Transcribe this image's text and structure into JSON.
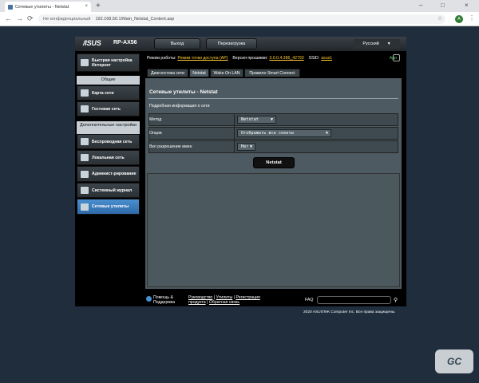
{
  "browser": {
    "tab_title": "Сетевые утилиты - Netstat",
    "close_glyph": "×",
    "newtab_glyph": "+",
    "nav": {
      "back": "←",
      "forward": "→",
      "reload": "⟳"
    },
    "security_label": "Не конфиденциальный",
    "url": "192.168.50.1/Main_Netstat_Content.asp",
    "avatar_letter": "A",
    "window_controls": {
      "minimize": "–",
      "maximize": "□",
      "close": "×"
    }
  },
  "router": {
    "brand": "/ISUS",
    "model": "RP-AX56",
    "logout_label": "Выход",
    "reboot_label": "Перезагрузка",
    "language": "Русский",
    "status": {
      "mode_label": "Режим работы:",
      "mode_value": "Режим точки доступа (AP)",
      "firmware_label": "Версия прошивки:",
      "firmware_value": "3.0.0.4.386_42793",
      "ssid_label": "SSID:",
      "ssid_value": "asus1",
      "app_label": "App"
    },
    "sidebar": {
      "quick_setup": "Быстрая настройка Интернет",
      "general_header": "Общие",
      "general_items": [
        "Карта сети",
        "Гостевая сеть"
      ],
      "advanced_header": "Дополнительные настройки",
      "advanced_items": [
        "Беспроводная сеть",
        "Локальная сеть",
        "Админист-рирование",
        "Системный журнал",
        "Сетевые утилиты"
      ]
    },
    "tabs": [
      "Диагностика сети",
      "Netstat",
      "Wake On LAN",
      "Правило Smart Connect"
    ],
    "panel": {
      "title": "Сетевые утилиты - Netstat",
      "subtitle": "Подробная информация о сети",
      "fields": [
        {
          "label": "Метод",
          "value": "Netstat"
        },
        {
          "label": "Опции",
          "value": "Отображать все сокеты"
        },
        {
          "label": "Вкл разрешение имен",
          "value": "Нет"
        }
      ],
      "action_label": "Netstat"
    },
    "footer": {
      "help": "Помощь & Поддержка",
      "links_line1": [
        "Руководство",
        "Утилиты",
        "Регистрация"
      ],
      "links_line2": [
        "продукта",
        "Обратная связь"
      ],
      "separator": "|",
      "faq_label": "FAQ"
    },
    "copyright": "2020 ASUSTeK Computer Inc. Все права защищены.",
    "watermark": "GC"
  }
}
